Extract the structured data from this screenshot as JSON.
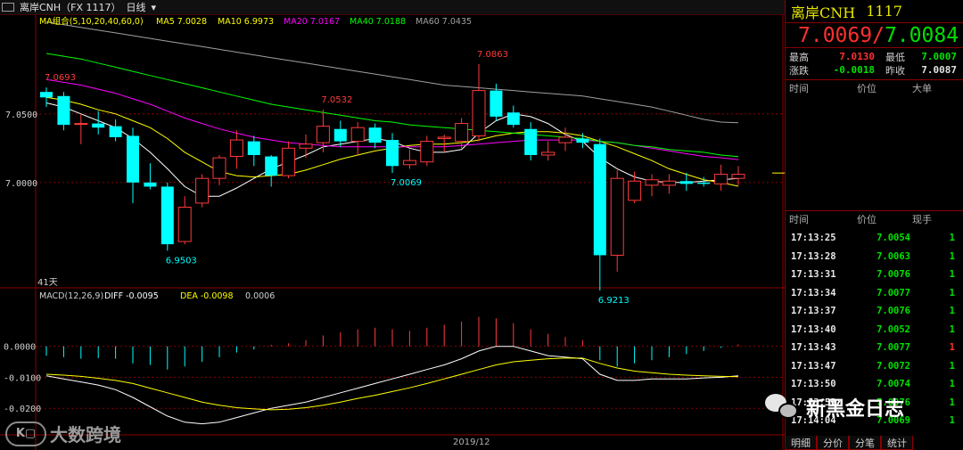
{
  "topbar": {
    "symbol": "离岸CNH（FX 1117）",
    "period": "日线",
    "menu_glyph": "▾"
  },
  "legends": {
    "ma_group": "MA组合(5,10,20,40,60,0)",
    "ma5": "MA5 7.0028",
    "ma10": "MA10 6.9973",
    "ma20": "MA20 7.0167",
    "ma40": "MA40 7.0188",
    "ma60": "MA60 7.0435",
    "macd": "MACD(12,26,9)",
    "diff": "DIFF -0.0095",
    "dea": "DEA -0.0098",
    "macd_val": "0.0006"
  },
  "colors": {
    "up": "#ff3a3a",
    "down": "#00ffff",
    "ma5": "#ffffff",
    "ma10": "#ffff00",
    "ma20": "#ff00ff",
    "ma40": "#00ff00",
    "ma60": "#a0a0a0",
    "grid": "#8b0000"
  },
  "price_axis": [
    "7.0500",
    "7.0000"
  ],
  "macd_axis": [
    "0.0000",
    "-0.0100",
    "-0.0200"
  ],
  "bottom_label": "41天",
  "date_label": "2019/12",
  "annotations": [
    "7.0693",
    "7.0532",
    "7.0863",
    "7.0069",
    "6.9503",
    "6.9213"
  ],
  "chart_data": {
    "type": "candlestick",
    "ylim": [
      6.92,
      7.12
    ],
    "candles": [
      {
        "o": 7.066,
        "c": 7.062,
        "h": 7.0693,
        "l": 7.055
      },
      {
        "o": 7.063,
        "c": 7.042,
        "h": 7.066,
        "l": 7.038
      },
      {
        "o": 7.043,
        "c": 7.043,
        "h": 7.05,
        "l": 7.028
      },
      {
        "o": 7.043,
        "c": 7.04,
        "h": 7.052,
        "l": 7.035
      },
      {
        "o": 7.041,
        "c": 7.033,
        "h": 7.046,
        "l": 7.03
      },
      {
        "o": 7.034,
        "c": 7.0,
        "h": 7.04,
        "l": 6.985
      },
      {
        "o": 7.0,
        "c": 6.997,
        "h": 7.014,
        "l": 6.995
      },
      {
        "o": 6.997,
        "c": 6.955,
        "h": 7.0,
        "l": 6.9503
      },
      {
        "o": 6.957,
        "c": 6.982,
        "h": 6.99,
        "l": 6.955
      },
      {
        "o": 6.985,
        "c": 7.003,
        "h": 7.006,
        "l": 6.982
      },
      {
        "o": 7.003,
        "c": 7.018,
        "h": 7.02,
        "l": 6.998
      },
      {
        "o": 7.019,
        "c": 7.031,
        "h": 7.038,
        "l": 7.01
      },
      {
        "o": 7.03,
        "c": 7.02,
        "h": 7.034,
        "l": 7.012
      },
      {
        "o": 7.019,
        "c": 7.005,
        "h": 7.02,
        "l": 6.997
      },
      {
        "o": 7.005,
        "c": 7.025,
        "h": 7.03,
        "l": 7.003
      },
      {
        "o": 7.025,
        "c": 7.028,
        "h": 7.035,
        "l": 7.018
      },
      {
        "o": 7.029,
        "c": 7.041,
        "h": 7.0532,
        "l": 7.022
      },
      {
        "o": 7.039,
        "c": 7.03,
        "h": 7.045,
        "l": 7.026
      },
      {
        "o": 7.03,
        "c": 7.04,
        "h": 7.044,
        "l": 7.02
      },
      {
        "o": 7.04,
        "c": 7.029,
        "h": 7.043,
        "l": 7.025
      },
      {
        "o": 7.031,
        "c": 7.012,
        "h": 7.036,
        "l": 7.0069
      },
      {
        "o": 7.013,
        "c": 7.016,
        "h": 7.024,
        "l": 7.01
      },
      {
        "o": 7.015,
        "c": 7.03,
        "h": 7.034,
        "l": 7.012
      },
      {
        "o": 7.032,
        "c": 7.033,
        "h": 7.035,
        "l": 7.022
      },
      {
        "o": 7.03,
        "c": 7.043,
        "h": 7.047,
        "l": 7.025
      },
      {
        "o": 7.034,
        "c": 7.067,
        "h": 7.0863,
        "l": 7.03
      },
      {
        "o": 7.067,
        "c": 7.048,
        "h": 7.072,
        "l": 7.045
      },
      {
        "o": 7.051,
        "c": 7.042,
        "h": 7.056,
        "l": 7.04
      },
      {
        "o": 7.039,
        "c": 7.02,
        "h": 7.044,
        "l": 7.016
      },
      {
        "o": 7.02,
        "c": 7.022,
        "h": 7.03,
        "l": 7.016
      },
      {
        "o": 7.029,
        "c": 7.033,
        "h": 7.04,
        "l": 7.023
      },
      {
        "o": 7.032,
        "c": 7.029,
        "h": 7.036,
        "l": 7.025
      },
      {
        "o": 7.028,
        "c": 6.947,
        "h": 7.032,
        "l": 6.9213
      },
      {
        "o": 6.947,
        "c": 7.003,
        "h": 7.009,
        "l": 6.935
      },
      {
        "o": 6.987,
        "c": 7.001,
        "h": 7.008,
        "l": 6.985
      },
      {
        "o": 6.998,
        "c": 7.002,
        "h": 7.006,
        "l": 6.99
      },
      {
        "o": 6.998,
        "c": 7.001,
        "h": 7.006,
        "l": 6.992
      },
      {
        "o": 7.001,
        "c": 6.999,
        "h": 7.007,
        "l": 6.994
      },
      {
        "o": 7.0,
        "c": 6.999,
        "h": 7.004,
        "l": 6.997
      },
      {
        "o": 6.999,
        "c": 7.006,
        "h": 7.013,
        "l": 6.994
      },
      {
        "o": 7.003,
        "c": 7.006,
        "h": 7.012,
        "l": 6.998
      }
    ],
    "ma": {
      "ma5": [
        7.058,
        7.055,
        7.05,
        7.045,
        7.04,
        7.032,
        7.022,
        7.01,
        6.997,
        6.99,
        6.99,
        6.996,
        7.003,
        7.01,
        7.015,
        7.02,
        7.026,
        7.028,
        7.03,
        7.032,
        7.03,
        7.025,
        7.022,
        7.022,
        7.024,
        7.036,
        7.045,
        7.05,
        7.048,
        7.043,
        7.035,
        7.03,
        7.018,
        7.01,
        7.004,
        7.001,
        7.0,
        7.0,
        7.001,
        7.002,
        7.003
      ],
      "ma10": [
        7.062,
        7.06,
        7.057,
        7.053,
        7.05,
        7.045,
        7.04,
        7.032,
        7.022,
        7.015,
        7.008,
        7.005,
        7.004,
        7.005,
        7.006,
        7.009,
        7.013,
        7.017,
        7.02,
        7.023,
        7.025,
        7.027,
        7.028,
        7.028,
        7.029,
        7.031,
        7.034,
        7.036,
        7.037,
        7.037,
        7.036,
        7.034,
        7.03,
        7.026,
        7.021,
        7.016,
        7.01,
        7.006,
        7.002,
        7.0,
        6.9973
      ],
      "ma20": [
        7.075,
        7.073,
        7.071,
        7.068,
        7.065,
        7.061,
        7.057,
        7.052,
        7.047,
        7.043,
        7.039,
        7.036,
        7.033,
        7.031,
        7.029,
        7.028,
        7.027,
        7.026,
        7.026,
        7.026,
        7.026,
        7.026,
        7.026,
        7.026,
        7.027,
        7.028,
        7.029,
        7.03,
        7.031,
        7.031,
        7.031,
        7.031,
        7.03,
        7.029,
        7.027,
        7.025,
        7.023,
        7.021,
        7.019,
        7.018,
        7.0167
      ],
      "ma40": [
        7.094,
        7.092,
        7.09,
        7.087,
        7.084,
        7.081,
        7.078,
        7.075,
        7.072,
        7.069,
        7.066,
        7.063,
        7.06,
        7.057,
        7.055,
        7.053,
        7.051,
        7.049,
        7.047,
        7.045,
        7.044,
        7.042,
        7.041,
        7.04,
        7.039,
        7.038,
        7.037,
        7.036,
        7.035,
        7.034,
        7.033,
        7.032,
        7.03,
        7.029,
        7.027,
        7.026,
        7.024,
        7.023,
        7.022,
        7.02,
        7.0188
      ],
      "ma60": [
        7.117,
        7.115,
        7.113,
        7.111,
        7.109,
        7.107,
        7.105,
        7.103,
        7.101,
        7.099,
        7.097,
        7.095,
        7.093,
        7.091,
        7.089,
        7.087,
        7.085,
        7.083,
        7.081,
        7.079,
        7.077,
        7.075,
        7.073,
        7.071,
        7.07,
        7.069,
        7.068,
        7.067,
        7.066,
        7.065,
        7.064,
        7.063,
        7.061,
        7.059,
        7.057,
        7.055,
        7.052,
        7.049,
        7.046,
        7.044,
        7.0435
      ]
    },
    "macd": {
      "ylim": [
        -0.028,
        0.014
      ],
      "hist": [
        -0.003,
        -0.0035,
        -0.004,
        -0.0038,
        -0.004,
        -0.0055,
        -0.006,
        -0.0075,
        -0.0065,
        -0.005,
        -0.0035,
        -0.002,
        -0.001,
        0.0005,
        0.001,
        0.002,
        0.0035,
        0.0045,
        0.0055,
        0.006,
        0.0055,
        0.005,
        0.006,
        0.007,
        0.008,
        0.0095,
        0.009,
        0.0075,
        0.0055,
        0.004,
        0.003,
        0.002,
        -0.0045,
        -0.0065,
        -0.0055,
        -0.0045,
        -0.0035,
        -0.0025,
        -0.0015,
        -0.0005,
        0.0006
      ],
      "diff": [
        -0.0095,
        -0.0105,
        -0.0115,
        -0.0125,
        -0.014,
        -0.0165,
        -0.0195,
        -0.0225,
        -0.0245,
        -0.025,
        -0.0245,
        -0.023,
        -0.0215,
        -0.02,
        -0.019,
        -0.018,
        -0.0165,
        -0.015,
        -0.0135,
        -0.012,
        -0.0105,
        -0.009,
        -0.0075,
        -0.006,
        -0.004,
        -0.0015,
        0.0,
        0.0,
        -0.0015,
        -0.003,
        -0.0035,
        -0.004,
        -0.009,
        -0.011,
        -0.011,
        -0.0105,
        -0.0105,
        -0.0105,
        -0.0102,
        -0.01,
        -0.0095
      ],
      "dea": [
        -0.009,
        -0.0093,
        -0.0097,
        -0.0103,
        -0.011,
        -0.012,
        -0.0135,
        -0.015,
        -0.0165,
        -0.018,
        -0.019,
        -0.0198,
        -0.0202,
        -0.0205,
        -0.0203,
        -0.0198,
        -0.019,
        -0.018,
        -0.0168,
        -0.0158,
        -0.0146,
        -0.0134,
        -0.012,
        -0.0105,
        -0.009,
        -0.0075,
        -0.006,
        -0.005,
        -0.0045,
        -0.004,
        -0.0038,
        -0.0038,
        -0.0055,
        -0.007,
        -0.008,
        -0.0085,
        -0.009,
        -0.0093,
        -0.0095,
        -0.0097,
        -0.0098
      ]
    }
  },
  "right_panel": {
    "name": "离岸CNH",
    "code": "1117",
    "bid": "7.0069",
    "ask": "7.0084",
    "sep": "/",
    "high_lbl": "最高",
    "high": "7.0130",
    "low_lbl": "最低",
    "low": "7.0007",
    "chg_lbl": "涨跌",
    "chg": "-0.0018",
    "prev_lbl": "昨收",
    "prev": "7.0087",
    "book_hdr": [
      "时间",
      "价位",
      "大单"
    ],
    "ticks_hdr": [
      "时间",
      "价位",
      "现手"
    ],
    "ticks": [
      {
        "t": "17:13:25",
        "p": "7.0054",
        "q": "1",
        "pc": "green",
        "qc": "green"
      },
      {
        "t": "17:13:28",
        "p": "7.0063",
        "q": "1",
        "pc": "green",
        "qc": "green"
      },
      {
        "t": "17:13:31",
        "p": "7.0076",
        "q": "1",
        "pc": "green",
        "qc": "green"
      },
      {
        "t": "17:13:34",
        "p": "7.0077",
        "q": "1",
        "pc": "green",
        "qc": "green"
      },
      {
        "t": "17:13:37",
        "p": "7.0076",
        "q": "1",
        "pc": "green",
        "qc": "green"
      },
      {
        "t": "17:13:40",
        "p": "7.0052",
        "q": "1",
        "pc": "green",
        "qc": "green"
      },
      {
        "t": "17:13:43",
        "p": "7.0077",
        "q": "1",
        "pc": "green",
        "qc": "red"
      },
      {
        "t": "17:13:47",
        "p": "7.0072",
        "q": "1",
        "pc": "green",
        "qc": "green"
      },
      {
        "t": "17:13:50",
        "p": "7.0074",
        "q": "1",
        "pc": "green",
        "qc": "green"
      },
      {
        "t": "17:13:53",
        "p": "7.0076",
        "q": "1",
        "pc": "green",
        "qc": "green"
      },
      {
        "t": "17:14:04",
        "p": "7.0069",
        "q": "1",
        "pc": "green",
        "qc": "green"
      }
    ],
    "tabs": [
      "明细",
      "分价",
      "分笔",
      "统计"
    ]
  },
  "watermarks": {
    "left_logo": "K▢",
    "left_text": "大数跨境",
    "right_text": "新黑金日志"
  }
}
